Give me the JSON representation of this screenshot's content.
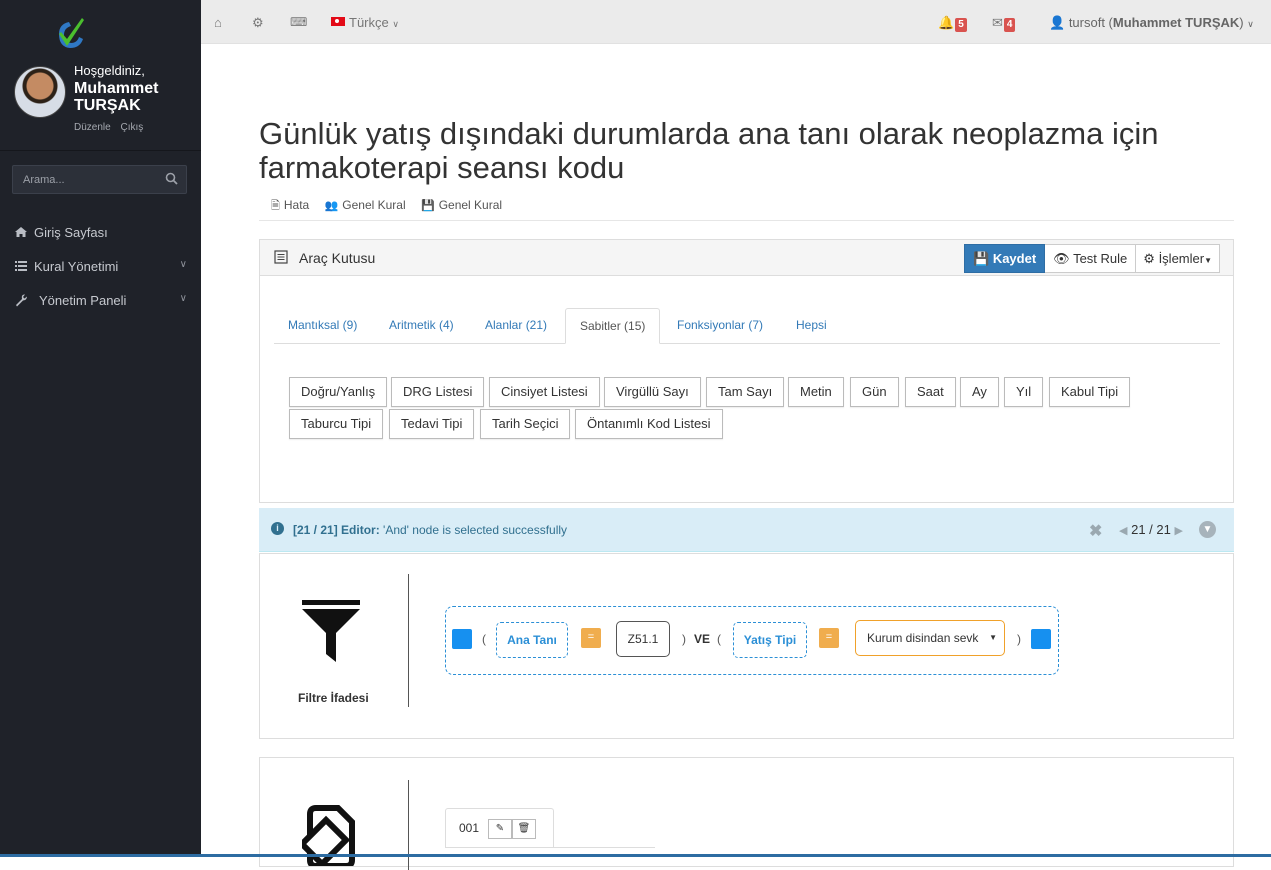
{
  "sidebar": {
    "welcome": "Hoşgeldiniz,",
    "user_name": "Muhammet TURŞAK",
    "edit_link": "Düzenle",
    "logout_link": "Çıkış",
    "search_placeholder": "Arama...",
    "items": [
      {
        "label": "Giriş Sayfası",
        "icon": "home-icon"
      },
      {
        "label": "Kural Yönetimi",
        "icon": "list-icon"
      },
      {
        "label": "Yönetim Paneli",
        "icon": "wrench-icon"
      }
    ]
  },
  "topbar": {
    "language": "Türkçe",
    "notifications_count": "5",
    "messages_count": "4",
    "user_login": "tursoft",
    "user_display": "Muhammet TURŞAK"
  },
  "page": {
    "title": "Günlük yatış dışındaki durumlarda ana tanı olarak neoplazma için farmakoterapi seansı kodu",
    "meta": [
      "Hata",
      "Genel Kural",
      "Genel Kural"
    ]
  },
  "toolbox": {
    "title": "Araç Kutusu",
    "save_label": "Kaydet",
    "test_label": "Test Rule",
    "actions_label": "İşlemler",
    "tabs": [
      "Mantıksal (9)",
      "Aritmetik (4)",
      "Alanlar (21)",
      "Sabitler (15)",
      "Fonksiyonlar (7)",
      "Hepsi"
    ],
    "active_tab": "Sabitler (15)",
    "constants": [
      "Doğru/Yanlış",
      "DRG Listesi",
      "Cinsiyet Listesi",
      "Virgüllü Sayı",
      "Tam Sayı",
      "Metin",
      "Gün",
      "Saat",
      "Ay",
      "Yıl",
      "Kabul Tipi",
      "Taburcu Tipi",
      "Tedavi Tipi",
      "Tarih Seçici",
      "Öntanımlı Kod Listesi"
    ]
  },
  "alert": {
    "prefix": "[21 / 21] Editor:",
    "message": "'And' node is selected successfully",
    "pager": "21 / 21"
  },
  "filter": {
    "label": "Filtre İfadesi",
    "open_paren": "(",
    "close_paren": ")",
    "field1": "Ana Tanı",
    "operator": "=",
    "value1": "Z51.1",
    "connector": "VE",
    "field2": "Yatış Tipi",
    "value2": "Kurum disindan sevk"
  },
  "result": {
    "tab_number": "001"
  },
  "colors": {
    "sidebar_bg": "#1f2229",
    "primary": "#337ab7",
    "alert_bg": "#d9edf7",
    "field_border": "#2b8fd6",
    "operator": "#f0ad4e",
    "badge": "#d9534f"
  }
}
